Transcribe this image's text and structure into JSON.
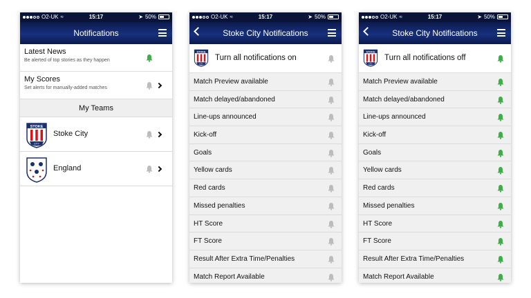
{
  "colors": {
    "bell_on": "#3fae49",
    "bell_off": "#bcbcbc",
    "nav": "#14266a"
  },
  "status_bar": {
    "carrier": "O2-UK",
    "time": "15:17",
    "battery": "50%",
    "battery_level": 0.5
  },
  "screen1": {
    "title": "Notifications",
    "rows": [
      {
        "title": "Latest News",
        "subtitle": "Be alerted of top stories as they happen",
        "bell": "on"
      },
      {
        "title": "My Scores",
        "subtitle": "Set alerts for manually-added matches",
        "bell": "off"
      }
    ],
    "section_title": "My Teams",
    "teams": [
      {
        "name": "Stoke City",
        "bell": "off",
        "crest": "stoke-city-crest"
      },
      {
        "name": "England",
        "bell": "off",
        "crest": "england-crest"
      }
    ]
  },
  "screen2": {
    "title": "Stoke City Notifications",
    "master_label": "Turn all notifications on",
    "bells": "off"
  },
  "screen3": {
    "title": "Stoke City Notifications",
    "master_label": "Turn all notifications off",
    "bells": "on"
  },
  "options": [
    "Match Preview available",
    "Match delayed/abandoned",
    "Line-ups announced",
    "Kick-off",
    "Goals",
    "Yellow cards",
    "Red cards",
    "Missed penalties",
    "HT Score",
    "FT Score",
    "Result After Extra Time/Penalties",
    "Match Report Available"
  ],
  "crest_text": {
    "stoke_top": "STOKE",
    "stoke_bottom": "CITY"
  }
}
